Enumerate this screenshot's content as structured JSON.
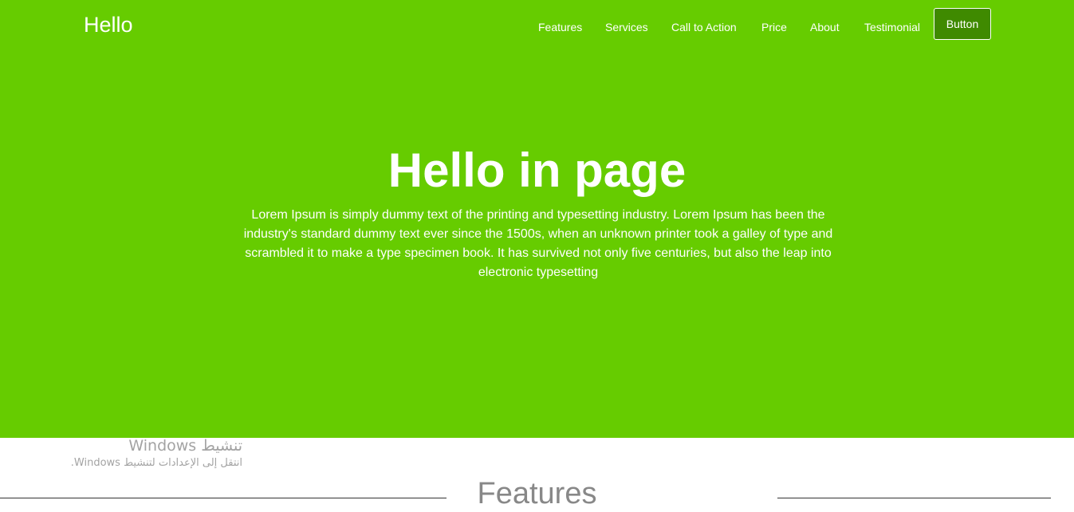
{
  "header": {
    "brand": "Hello",
    "nav_items": [
      "Features",
      "Services",
      "Call to Action",
      "Price",
      "About",
      "Testimonial"
    ],
    "button_label": "Button"
  },
  "hero": {
    "title": "Hello in page",
    "text": "Lorem Ipsum is simply dummy text of the printing and typesetting industry. Lorem Ipsum has been the industry's standard dummy text ever since the 1500s, when an unknown printer took a galley of type and scrambled it to make a type specimen book. It has survived not only five centuries, but also the leap into electronic typesetting"
  },
  "activation_watermark": {
    "title": "تنشيط Windows",
    "subtitle": "انتقل إلى الإعدادات لتنشيط Windows."
  },
  "features": {
    "heading": "Features"
  },
  "colors": {
    "hero_background": "#66cc00",
    "button_background": "#3f8a00",
    "text": "#ffffff"
  }
}
